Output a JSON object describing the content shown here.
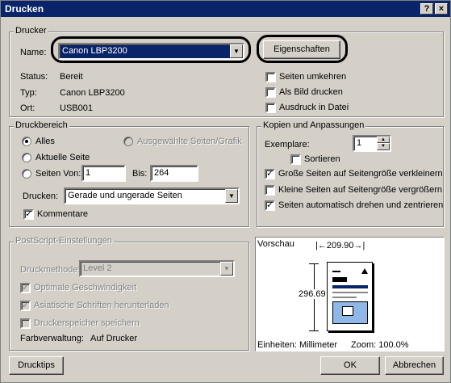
{
  "window": {
    "title": "Drucken",
    "help_btn": "?",
    "close_btn": "×"
  },
  "printer": {
    "group_label": "Drucker",
    "name_label": "Name:",
    "name_value": "Canon LBP3200",
    "properties_btn": "Eigenschaften",
    "status_label": "Status:",
    "status_value": "Bereit",
    "type_label": "Typ:",
    "type_value": "Canon LBP3200",
    "location_label": "Ort:",
    "location_value": "USB001",
    "reverse_pages": "Seiten umkehren",
    "print_as_image": "Als Bild drucken",
    "print_to_file": "Ausdruck in Datei"
  },
  "range": {
    "group_label": "Druckbereich",
    "all": "Alles",
    "selected": "Ausgewählte Seiten/Grafik",
    "current": "Aktuelle Seite",
    "pages_from": "Seiten Von:",
    "from_value": "1",
    "to_label": "Bis:",
    "to_value": "264",
    "print_label": "Drucken:",
    "print_value": "Gerade und ungerade Seiten",
    "comments": "Kommentare"
  },
  "copies": {
    "group_label": "Kopien und Anpassungen",
    "copies_label": "Exemplare:",
    "copies_value": "1",
    "collate": "Sortieren",
    "shrink": "Große Seiten auf Seitengröße verkleinern",
    "expand": "Kleine Seiten auf Seitengröße vergrößern",
    "autorotate": "Seiten automatisch drehen und zentrieren"
  },
  "postscript": {
    "group_label": "PostScript-Einstellungen",
    "method_label": "Druckmethode:",
    "method_value": "Level 2",
    "optimize": "Optimale Geschwindigkeit",
    "asian_fonts": "Asiatische Schriften herunterladen",
    "save_memory": "Druckerspeicher speichern",
    "color_mgmt_label": "Farbverwaltung:",
    "color_mgmt_value": "Auf Drucker"
  },
  "preview": {
    "label": "Vorschau",
    "width": "209.90",
    "height": "296.69",
    "units_label": "Einheiten: Millimeter",
    "zoom_label": "Zoom: 100.0%"
  },
  "footer": {
    "tips_btn": "Drucktips",
    "ok_btn": "OK",
    "cancel_btn": "Abbrechen"
  },
  "checks": {
    "checkmark": "✓"
  }
}
